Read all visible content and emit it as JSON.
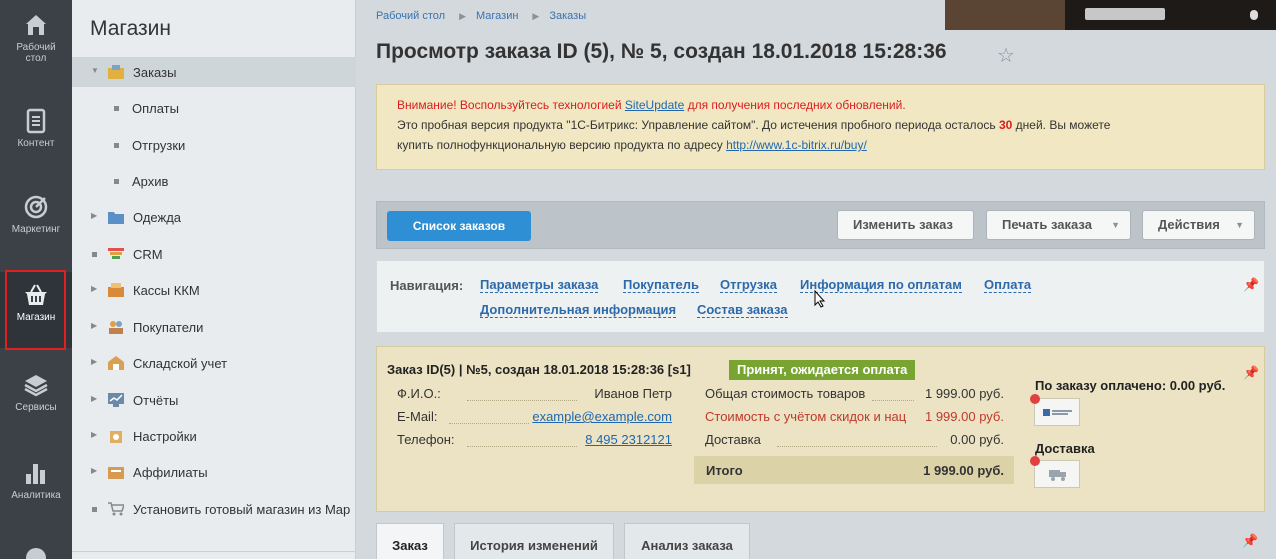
{
  "rail": {
    "items": [
      {
        "label_line1": "Рабочий",
        "label_line2": "стол",
        "icon": "home-icon"
      },
      {
        "label_line1": "Контент",
        "label_line2": "",
        "icon": "document-icon"
      },
      {
        "label_line1": "Маркетинг",
        "label_line2": "",
        "icon": "target-icon"
      },
      {
        "label_line1": "Магазин",
        "label_line2": "",
        "icon": "basket-icon"
      },
      {
        "label_line1": "Сервисы",
        "label_line2": "",
        "icon": "layers-icon"
      },
      {
        "label_line1": "Аналитика",
        "label_line2": "",
        "icon": "bar-chart-icon"
      }
    ]
  },
  "menu": {
    "title": "Магазин",
    "items": [
      {
        "label": "Заказы"
      },
      {
        "label": "Оплаты"
      },
      {
        "label": "Отгрузки"
      },
      {
        "label": "Архив"
      },
      {
        "label": "Одежда"
      },
      {
        "label": "CRM"
      },
      {
        "label": "Кассы ККМ"
      },
      {
        "label": "Покупатели"
      },
      {
        "label": "Складской учет"
      },
      {
        "label": "Отчёты"
      },
      {
        "label": "Настройки"
      },
      {
        "label": "Аффилиаты"
      },
      {
        "label": "Установить готовый магазин из Map"
      }
    ]
  },
  "breadcrumb": [
    "Рабочий стол",
    "Магазин",
    "Заказы"
  ],
  "page_title": "Просмотр заказа ID (5), № 5, создан 18.01.2018 15:28:36",
  "alert": {
    "warn_prefix": "Внимание! Воспользуйтесь технологией ",
    "warn_link": "SiteUpdate",
    "warn_suffix": " для получения последних обновлений.",
    "line2_prefix": "Это пробная версия продукта \"1С-Битрикс: Управление сайтом\". До истечения пробного периода осталось ",
    "days": "30",
    "line2_suffix": " дней. Вы можете",
    "line3_prefix": "купить полнофункциональную версию продукта по адресу ",
    "buy_link": "http://www.1c-bitrix.ru/buy/"
  },
  "toolbar": {
    "back_label": "Список заказов",
    "edit_label": "Изменить заказ",
    "print_label": "Печать заказа",
    "actions_label": "Действия"
  },
  "navigation": {
    "label": "Навигация:",
    "links": [
      "Параметры заказа",
      "Покупатель",
      "Отгрузка",
      "Информация по оплатам",
      "Оплата",
      "Дополнительная информация",
      "Состав заказа"
    ]
  },
  "order": {
    "heading": "Заказ ID(5) | №5, создан 18.01.2018 15:28:36 [s1]",
    "status": "Принят, ожидается оплата",
    "fio_label": "Ф.И.О.:",
    "fio_value": "Иванов Петр",
    "email_label": "E-Mail:",
    "email_value": "example@example.com",
    "phone_label": "Телефон:",
    "phone_value": "8 495 2312121",
    "goods_label": "Общая стоимость товаров",
    "goods_value": "1 999.00 руб.",
    "discount_label": "Стоимость с учётом скидок и нац",
    "discount_value": "1 999.00 руб.",
    "delivery_label": "Доставка",
    "delivery_value": "0.00 руб.",
    "total_label": "Итого",
    "total_value": "1 999.00 руб.",
    "paid_title": "По заказу оплачено: 0.00 руб.",
    "delivery_title": "Доставка"
  },
  "tabs": [
    "Заказ",
    "История изменений",
    "Анализ заказа"
  ],
  "colors": {
    "accent": "#2e8fd5",
    "status": "#78a532",
    "warning": "#d81e1e",
    "highlight_box": "#e02020"
  }
}
